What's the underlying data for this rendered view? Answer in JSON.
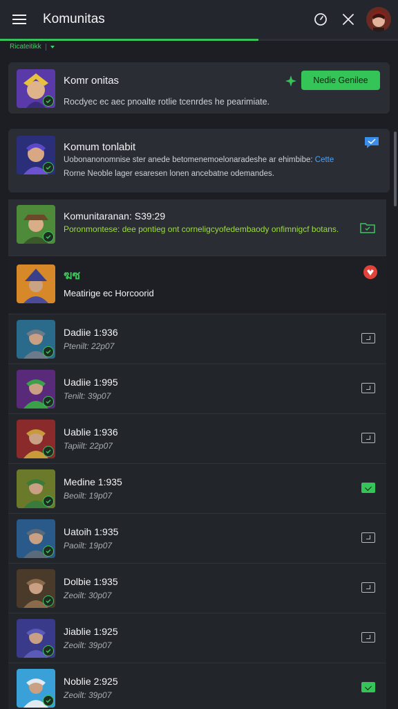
{
  "app": {
    "title": "Komunitas"
  },
  "breadcrumb": {
    "label": "Ricateitikk"
  },
  "progress": {
    "fraction": 0.65
  },
  "featured": {
    "title": "Komr onitas",
    "button": "Nedie Genilee",
    "desc": "Rocdyec ec aec pnoalte rotlie tcenrdes he pearimiate."
  },
  "card2": {
    "title": "Komum tonlabit",
    "desc_line1": "Uobonanonomnise ster anede betomenemoelonaradeshe ar ehimbibe:",
    "link": "Cette",
    "desc_line2": "Rorne Neoble lager esaresen lonen ancebatne odemandes."
  },
  "card3": {
    "title": "Komunitaranan: S39:29",
    "desc": "Poronmontese: dee pontieg ont corneligcyofedembaody onfimnigcf botans."
  },
  "card4": {
    "emblem": "ฆซ",
    "subtitle": "Meatirige ec Horcoorid"
  },
  "rows": [
    {
      "title": "Dadiie 1:936",
      "sub": "Ptenilt: 22p07",
      "checked": false
    },
    {
      "title": "Uadiie 1:995",
      "sub": "Tenilt: 39p07",
      "checked": false
    },
    {
      "title": "Uablie 1:936",
      "sub": "Tapiilt: 22p07",
      "checked": false
    },
    {
      "title": "Medine 1:935",
      "sub": "Beoilt: 19p07",
      "checked": true
    },
    {
      "title": "Uatoih 1:935",
      "sub": "Paoilt: 19p07",
      "checked": false
    },
    {
      "title": "Dolbie 1:935",
      "sub": "Zeoilt: 30p07",
      "checked": false
    },
    {
      "title": "Jiablie 1:925",
      "sub": "Zeoilt: 39p07",
      "checked": false
    },
    {
      "title": "Noblie 2:925",
      "sub": "Zeoilt: 39p07",
      "checked": true
    }
  ],
  "colors": {
    "accent": "#35c457",
    "background": "#1c1e23",
    "card": "#2a2d33"
  }
}
